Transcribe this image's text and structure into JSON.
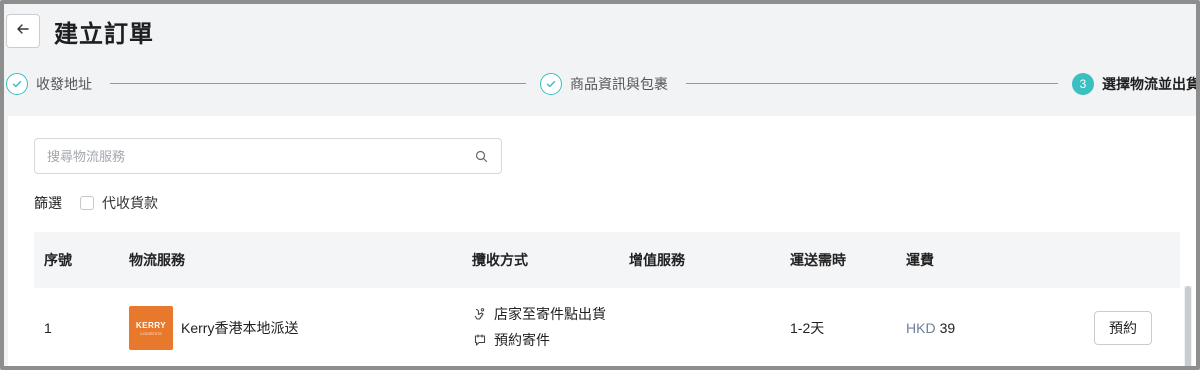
{
  "header": {
    "back_icon": "arrow-left-icon",
    "title": "建立訂單"
  },
  "stepper": {
    "steps": [
      {
        "label": "收發地址",
        "status": "done"
      },
      {
        "label": "商品資訊與包裹",
        "status": "done"
      },
      {
        "number": "3",
        "label": "選擇物流並出貨",
        "status": "active"
      }
    ],
    "accent_color": "#3bbfc0"
  },
  "search": {
    "placeholder": "搜尋物流服務",
    "value": ""
  },
  "filter": {
    "label": "篩選",
    "options": [
      {
        "label": "代收貨款",
        "checked": false
      }
    ]
  },
  "table": {
    "headers": [
      "序號",
      "物流服務",
      "攬收方式",
      "增值服務",
      "運送需時",
      "運費"
    ],
    "rows": [
      {
        "index": "1",
        "logo_text": "KERRY",
        "logo_subtext": "LOGISTICS",
        "service": "Kerry香港本地派送",
        "pickup_methods": [
          {
            "icon": "hand-drop-icon",
            "label": "店家至寄件點出貨"
          },
          {
            "icon": "calendar-chat-icon",
            "label": "預約寄件"
          }
        ],
        "value_added": "",
        "duration": "1-2天",
        "fee_currency": "HKD",
        "fee_amount": "39",
        "action_label": "預約"
      }
    ]
  },
  "colors": {
    "accent": "#3bbfc0",
    "kerry_orange": "#e8782c",
    "page_bg": "#f2f3f5"
  }
}
